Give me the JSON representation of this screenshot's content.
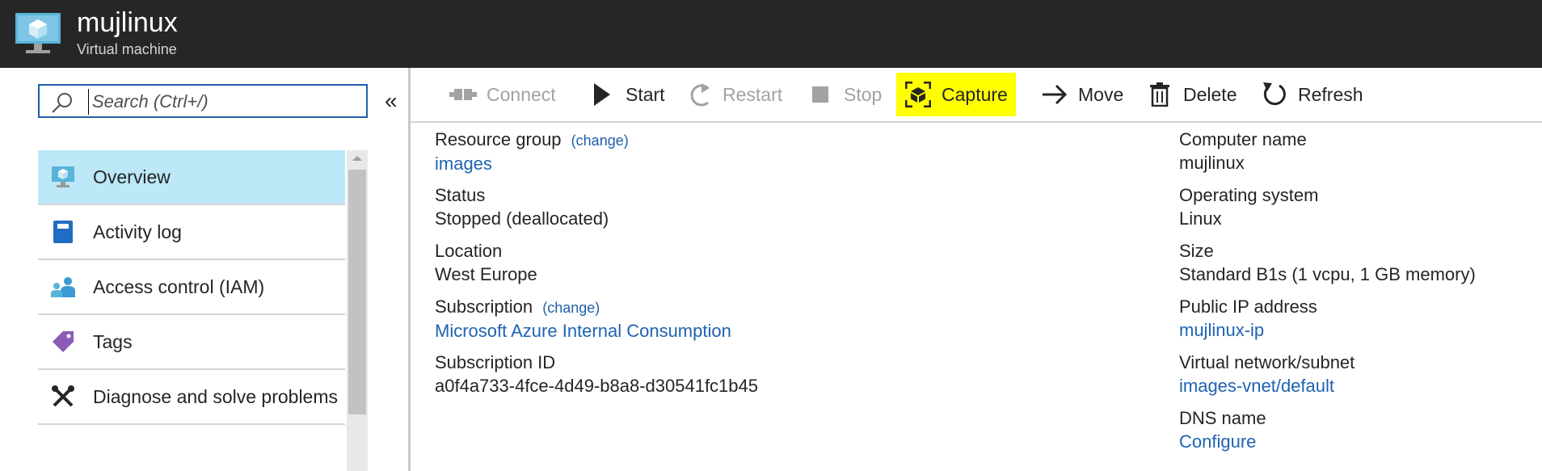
{
  "header": {
    "title": "mujlinux",
    "subtitle": "Virtual machine",
    "icon": "virtual-machine-icon"
  },
  "sidebar": {
    "search": {
      "placeholder": "Search (Ctrl+/)",
      "value": ""
    },
    "collapse_label": "«",
    "items": [
      {
        "label": "Overview",
        "icon": "monitor-icon",
        "active": true
      },
      {
        "label": "Activity log",
        "icon": "book-icon",
        "active": false
      },
      {
        "label": "Access control (IAM)",
        "icon": "users-icon",
        "active": false
      },
      {
        "label": "Tags",
        "icon": "tag-icon",
        "active": false
      },
      {
        "label": "Diagnose and solve problems",
        "icon": "wrench-icon",
        "active": false
      }
    ]
  },
  "toolbar": {
    "connect": "Connect",
    "start": "Start",
    "restart": "Restart",
    "stop": "Stop",
    "capture": "Capture",
    "move": "Move",
    "delete": "Delete",
    "refresh": "Refresh"
  },
  "properties": {
    "change_label": "change",
    "resource_group": {
      "label": "Resource group",
      "value": "images"
    },
    "status": {
      "label": "Status",
      "value": "Stopped (deallocated)"
    },
    "location": {
      "label": "Location",
      "value": "West Europe"
    },
    "subscription": {
      "label": "Subscription",
      "value": "Microsoft Azure Internal Consumption"
    },
    "subscription_id": {
      "label": "Subscription ID",
      "value": "a0f4a733-4fce-4d49-b8a8-d30541fc1b45"
    },
    "computer_name": {
      "label": "Computer name",
      "value": "mujlinux"
    },
    "os": {
      "label": "Operating system",
      "value": "Linux"
    },
    "size": {
      "label": "Size",
      "value": "Standard B1s (1 vcpu, 1 GB memory)"
    },
    "public_ip": {
      "label": "Public IP address",
      "value": "mujlinux-ip"
    },
    "vnet": {
      "label": "Virtual network/subnet",
      "value": "images-vnet/default"
    },
    "dns": {
      "label": "DNS name",
      "value": "Configure"
    }
  },
  "colors": {
    "header_bg": "#262626",
    "active_nav": "#bce8f8",
    "link": "#1f63b0",
    "capture_highlight": "#ffff00"
  }
}
